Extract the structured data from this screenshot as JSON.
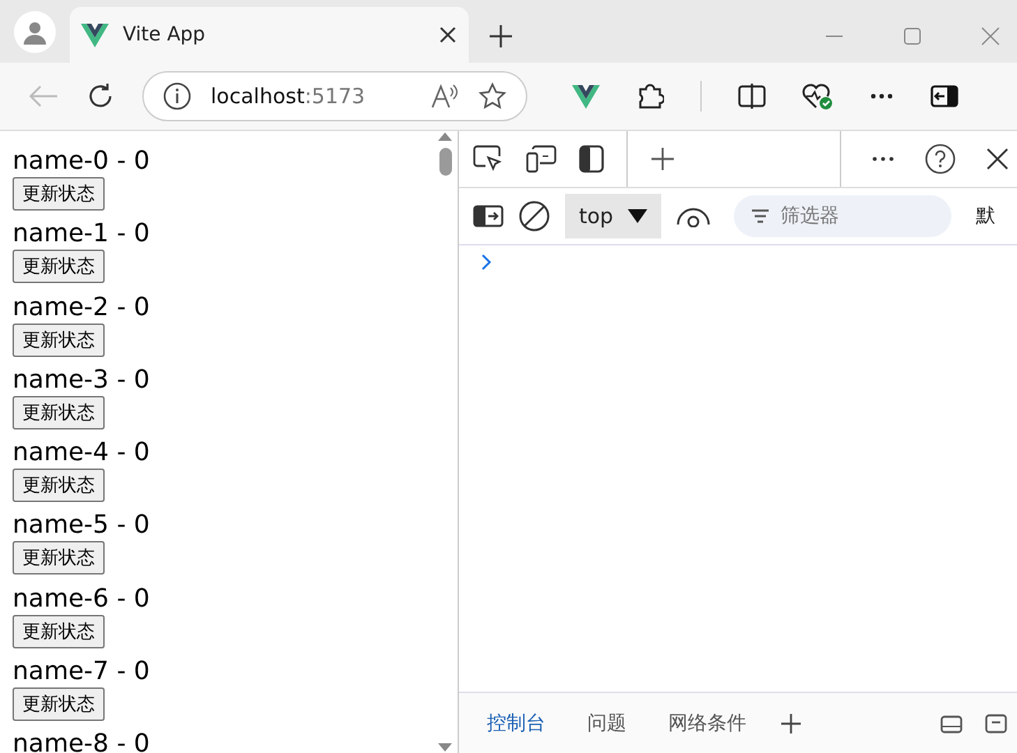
{
  "browser": {
    "tab": {
      "title": "Vite App"
    },
    "address": {
      "host": "localhost",
      "port": ":5173"
    }
  },
  "page": {
    "items": [
      {
        "label": "name-0 - 0",
        "button": "更新状态"
      },
      {
        "label": "name-1 - 0",
        "button": "更新状态"
      },
      {
        "label": "name-2 - 0",
        "button": "更新状态"
      },
      {
        "label": "name-3 - 0",
        "button": "更新状态"
      },
      {
        "label": "name-4 - 0",
        "button": "更新状态"
      },
      {
        "label": "name-5 - 0",
        "button": "更新状态"
      },
      {
        "label": "name-6 - 0",
        "button": "更新状态"
      },
      {
        "label": "name-7 - 0",
        "button": "更新状态"
      },
      {
        "label": "name-8 - 0"
      }
    ]
  },
  "devtools": {
    "context": "top",
    "filter": {
      "placeholder": "筛选器"
    },
    "levels": "默",
    "drawer_tabs": [
      {
        "label": "控制台",
        "selected": true
      },
      {
        "label": "问题",
        "selected": false
      },
      {
        "label": "网络条件",
        "selected": false
      }
    ]
  }
}
